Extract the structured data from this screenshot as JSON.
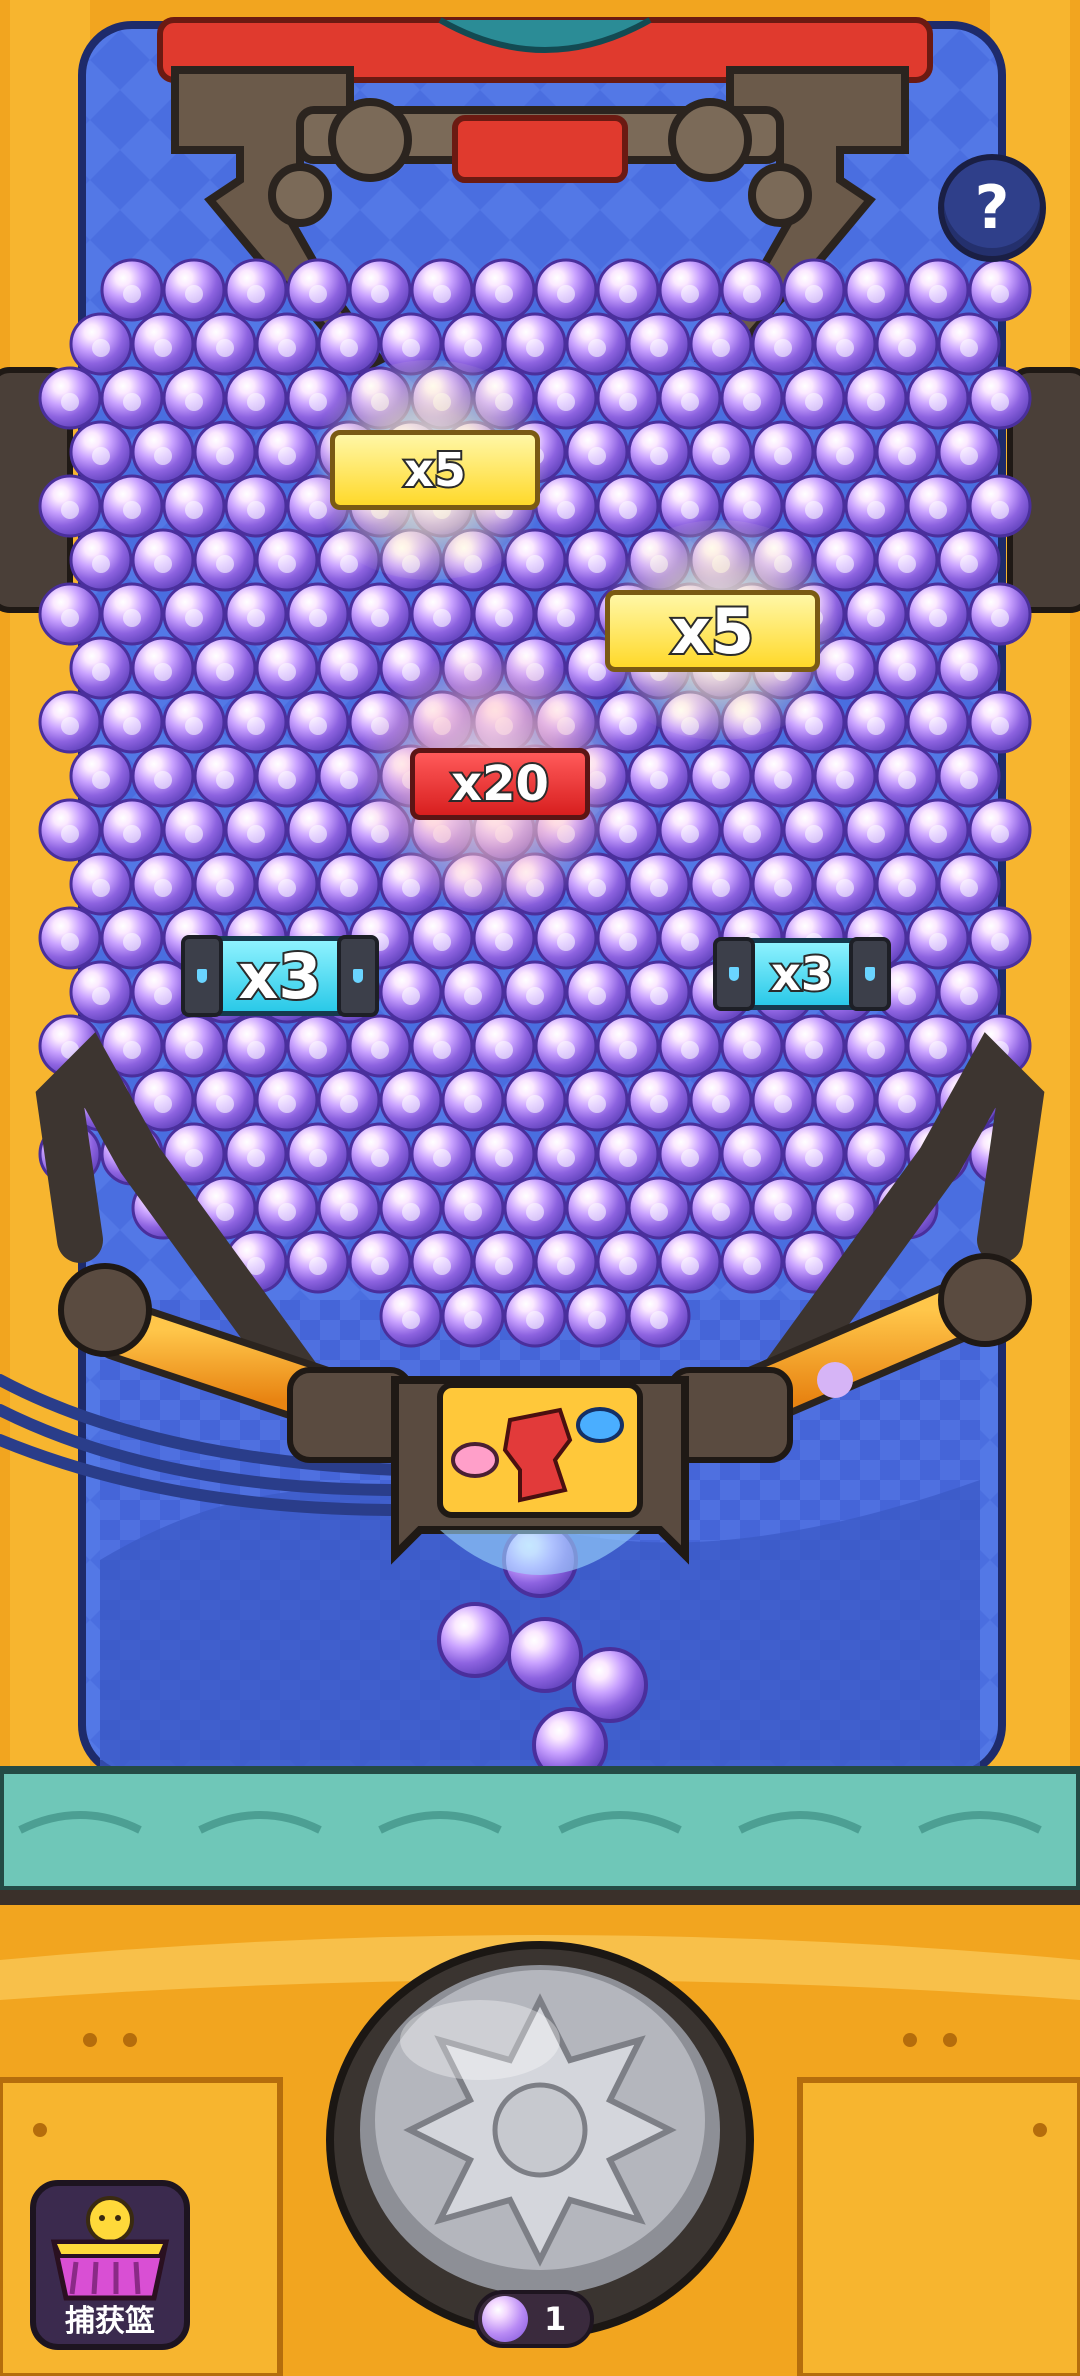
{
  "help": {
    "label": "?"
  },
  "multipliers": [
    {
      "label": "x5",
      "style": "yellow"
    },
    {
      "label": "x5",
      "style": "yellow"
    },
    {
      "label": "x20",
      "style": "red"
    },
    {
      "label": "x3",
      "style": "cyan"
    },
    {
      "label": "x3",
      "style": "cyan"
    }
  ],
  "basket": {
    "label": "捕获篮"
  },
  "ball_counter": {
    "count": "1"
  },
  "colors": {
    "frame": "#f2a51f",
    "backdrop": "#3f5ad1",
    "ball": "#b98bf5",
    "rail": "#6fc7b8"
  }
}
